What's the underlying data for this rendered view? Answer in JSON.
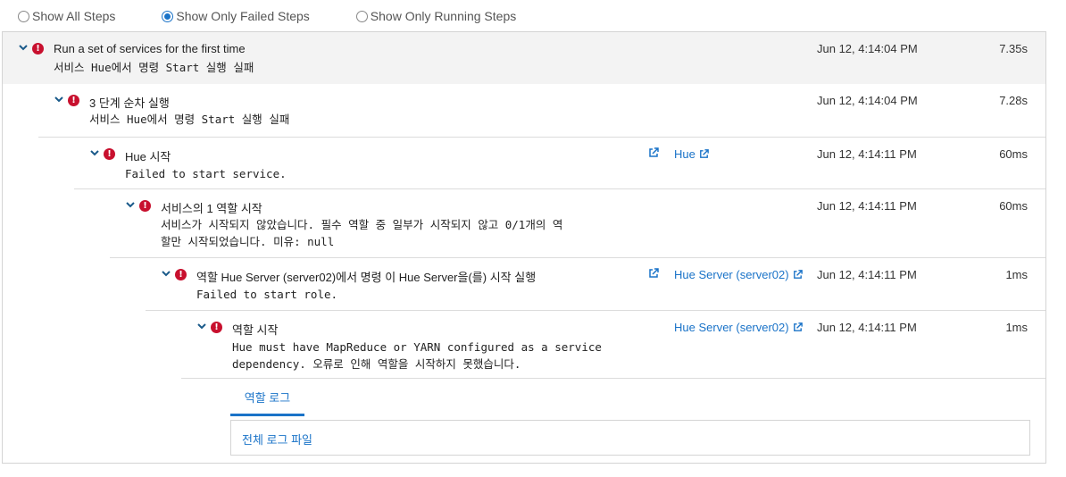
{
  "filters": [
    {
      "label": "Show All Steps",
      "checked": false
    },
    {
      "label": "Show Only Failed Steps",
      "checked": true
    },
    {
      "label": "Show Only Running Steps",
      "checked": false
    }
  ],
  "steps": [
    {
      "title": "Run a set of services for the first time",
      "message": "서비스 Hue에서 명령 Start 실행 실패",
      "time": "Jun 12, 4:14:04 PM",
      "duration": "7.35s"
    },
    {
      "title": "3 단계 순차 실행",
      "message": "서비스 Hue에서 명령 Start 실행 실패",
      "time": "Jun 12, 4:14:04 PM",
      "duration": "7.28s"
    },
    {
      "title": "Hue 시작",
      "message": "Failed to start service.",
      "link": "Hue",
      "time": "Jun 12, 4:14:11 PM",
      "duration": "60ms"
    },
    {
      "title": "서비스의 1 역할 시작",
      "message": "서비스가 시작되지 않았습니다. 필수 역할 중 일부가 시작되지 않고 0/1개의 역\n할만 시작되었습니다. 미유: null",
      "time": "Jun 12, 4:14:11 PM",
      "duration": "60ms"
    },
    {
      "title": "역할 Hue Server (server02)에서 명령 이 Hue Server을(를) 시작 실행",
      "message": "Failed to start role.",
      "link": "Hue Server (server02)",
      "time": "Jun 12, 4:14:11 PM",
      "duration": "1ms"
    },
    {
      "title": "역할 시작",
      "message": "Hue must have MapReduce or YARN configured as a service\ndependency. 오류로 인해 역할을 시작하지 못했습니다.",
      "link": "Hue Server (server02)",
      "time": "Jun 12, 4:14:11 PM",
      "duration": "1ms"
    }
  ],
  "log_tab": {
    "label": "역할 로그"
  },
  "log_link": {
    "label": "전체 로그 파일"
  },
  "colors": {
    "accent": "#1a73c8",
    "error": "#c8102e"
  }
}
